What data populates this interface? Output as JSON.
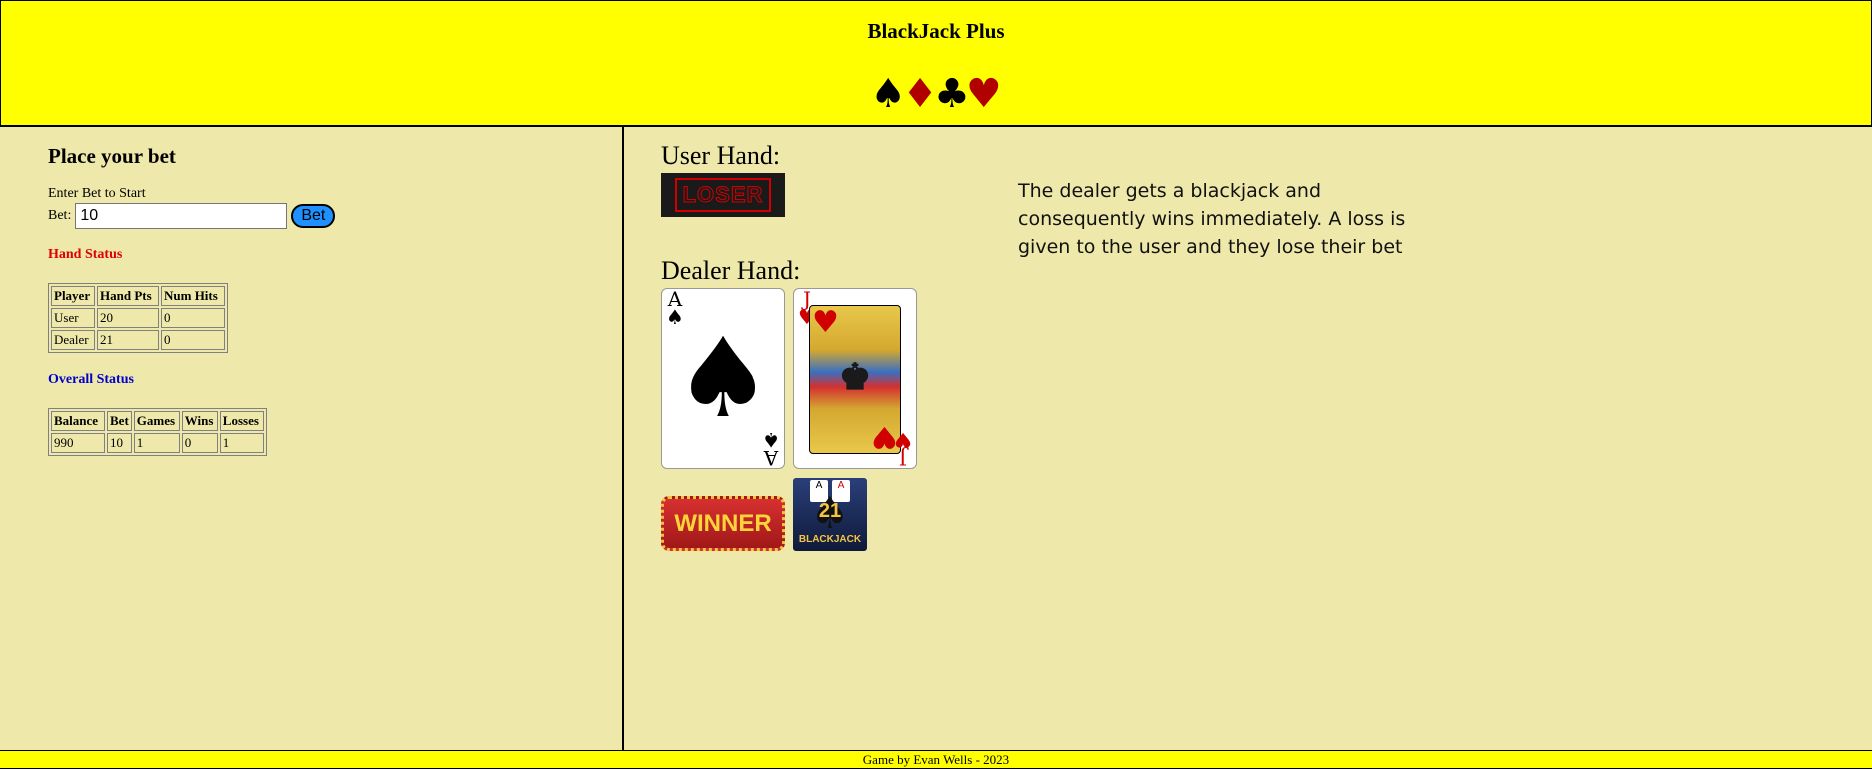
{
  "header": {
    "title": "BlackJack Plus",
    "suits": [
      "♠",
      "♦",
      "♣",
      "♥"
    ]
  },
  "bet_panel": {
    "title": "Place your bet",
    "prompt": "Enter Bet to Start",
    "bet_label": "Bet:",
    "bet_value": "10",
    "bet_button_label": "Bet"
  },
  "hand_status": {
    "title": "Hand Status",
    "title_color": "#e00000",
    "headers": [
      "Player",
      "Hand Pts",
      "Num Hits"
    ],
    "rows": [
      [
        "User",
        "20",
        "0"
      ],
      [
        "Dealer",
        "21",
        "0"
      ]
    ]
  },
  "overall_status": {
    "title": "Overall Status",
    "title_color": "#0000cc",
    "headers": [
      "Balance",
      "Bet",
      "Games",
      "Wins",
      "Losses"
    ],
    "rows": [
      [
        "990",
        "10",
        "1",
        "0",
        "1"
      ]
    ]
  },
  "user_hand": {
    "label": "User Hand:",
    "badge": "LOSER"
  },
  "dealer_hand": {
    "label": "Dealer Hand:",
    "cards": [
      {
        "rank": "A",
        "suit": "♠",
        "color": "#000000"
      },
      {
        "rank": "J",
        "suit": "♥",
        "color": "#d00000"
      }
    ],
    "winner_badge": "WINNER",
    "blackjack_badge": {
      "number": "21",
      "text": "BLACKJACK",
      "card_ranks": [
        "A",
        "A"
      ]
    }
  },
  "message": "The dealer gets a blackjack and consequently wins immediately. A loss is given to the user and they lose their bet",
  "footer": "Game by Evan Wells - 2023",
  "colors": {
    "header_bg": "#ffff00",
    "panel_bg": "#eee8aa",
    "bet_button": "#1e90ff"
  }
}
